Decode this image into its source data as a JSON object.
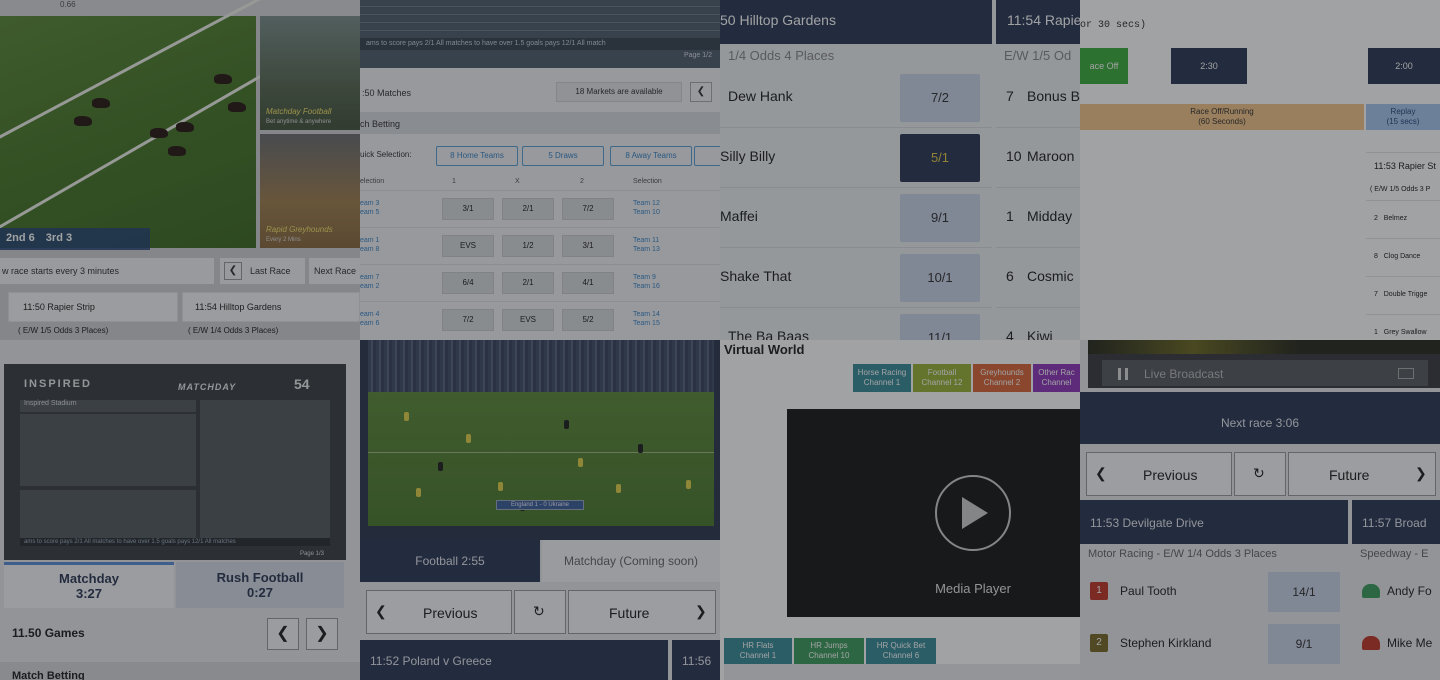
{
  "tile1": {
    "topstrip_text": "0.66",
    "hud": [
      "2nd 6",
      "3rd 3"
    ],
    "thumbs": [
      {
        "caption": "Matchday Football",
        "sub": "Bet anytime & anywhere"
      },
      {
        "caption": "Rapid Greyhounds",
        "sub": "Every 2 Mins"
      }
    ],
    "info_text": "w race starts every 3 minutes",
    "last_race": "Last Race",
    "next_race": "Next Race",
    "races": [
      {
        "name": "11:50 Rapier Strip",
        "odds": "( E/W 1/5 Odds 3 Places)"
      },
      {
        "name": "11:54 Hilltop Gardens",
        "odds": "( E/W 1/4 Odds 3 Places)"
      }
    ]
  },
  "tile2": {
    "ticker": "ams to score pays 2/1     All matches to have over 1.5 goals pays 12/1     All match",
    "page": "Page 1/2",
    "matches_label": ":50 Matches",
    "markets": "18 Markets are available",
    "match_betting": "ch Betting",
    "quick_selection": "uick Selection:",
    "quick_buttons": [
      "8 Home Teams",
      "5 Draws",
      "8 Away Teams"
    ],
    "col_headers": {
      "selection": "election",
      "c1": "1",
      "cx": "X",
      "c2": "2",
      "selection2": "Selection"
    },
    "rows": [
      {
        "home": "eam 3",
        "away": "eam 5",
        "o1": "3/1",
        "ox": "2/1",
        "o2": "7/2",
        "r1": "Team 12",
        "r2": "Team 10"
      },
      {
        "home": "eam 1",
        "away": "eam 8",
        "o1": "EVS",
        "ox": "1/2",
        "o2": "3/1",
        "r1": "Team 11",
        "r2": "Team 13"
      },
      {
        "home": "eam 7",
        "away": "eam 2",
        "o1": "6/4",
        "ox": "2/1",
        "o2": "4/1",
        "r1": "Team 9",
        "r2": "Team 16"
      },
      {
        "home": "eam 4",
        "away": "eam 6",
        "o1": "7/2",
        "ox": "EVS",
        "o2": "5/2",
        "r1": "Team 14",
        "r2": "Team 15"
      }
    ]
  },
  "tile3": {
    "header1": "50 Hilltop Gardens",
    "header2": "11:54 Rapier",
    "sub1": "1/4 Odds 4 Places",
    "sub2": "E/W 1/5 Od",
    "runners": [
      {
        "name": "Dew Hank",
        "price": "7/2"
      },
      {
        "name": "Silly Billy",
        "price": "5/1"
      },
      {
        "name": "Maffei",
        "price": "9/1"
      },
      {
        "name": "Shake That",
        "price": "10/1"
      },
      {
        "name": "The Ba Baas",
        "price": "11/1"
      }
    ],
    "runners2": [
      {
        "num": "7",
        "name": "Bonus B"
      },
      {
        "num": "10",
        "name": "Maroon"
      },
      {
        "num": "1",
        "name": "Midday"
      },
      {
        "num": "6",
        "name": "Cosmic"
      },
      {
        "num": "4",
        "name": "Kiwi"
      }
    ]
  },
  "tile4": {
    "code_text": "or 30 secs)",
    "blocks": [
      "ace Off",
      "2:30",
      "2:00"
    ],
    "band1": [
      "Race Off/Running",
      "(60 Seconds)"
    ],
    "band2": [
      "Replay",
      "(15 secs)"
    ],
    "race_name": "11:53 Rapier St",
    "race_odds": "( E/W 1/5 Odds 3 P",
    "entries": [
      {
        "num": "2",
        "name": "Belmez"
      },
      {
        "num": "8",
        "name": "Clog Dance"
      },
      {
        "num": "7",
        "name": "Double Trigge"
      },
      {
        "num": "1",
        "name": "Grey Swallow"
      }
    ]
  },
  "tile5": {
    "brand": "INSPIRED",
    "matchday": "MATCHDAY",
    "number": "54",
    "stadium": "Inspired Stadium",
    "ticker": "ams to score pays 2/1     All matches to have over 1.5 goals pays 12/1     All matches",
    "page": "Page 1/3",
    "tabs": [
      {
        "name": "Matchday",
        "time": "3:27"
      },
      {
        "name": "Rush Football",
        "time": "0:27"
      }
    ],
    "games": "11.50 Games",
    "match_betting": "Match Betting"
  },
  "tile6": {
    "score": "England 1 - 0 Ukraine",
    "tab_active": "Football 2:55",
    "tab_inactive": "Matchday (Coming soon)",
    "previous": "Previous",
    "future": "Future",
    "match1": "11:52 Poland v Greece",
    "match2": "11:56"
  },
  "tile7": {
    "title": "Virtual World",
    "channels": [
      {
        "l1": "Horse Racing",
        "l2": "Channel 1",
        "color": "#3b8c98"
      },
      {
        "l1": "Football",
        "l2": "Channel 12",
        "color": "#9cb33a"
      },
      {
        "l1": "Greyhounds",
        "l2": "Channel 2",
        "color": "#d9683a"
      },
      {
        "l1": "Other Rac",
        "l2": "Channel",
        "color": "#8e3ab8"
      }
    ],
    "media_label": "Media Player",
    "bottom_channels": [
      {
        "l1": "HR Flats",
        "l2": "Channel 1",
        "color": "#3b8c98"
      },
      {
        "l1": "HR Jumps",
        "l2": "Channel 10",
        "color": "#3f9c5c"
      },
      {
        "l1": "HR Quick Bet",
        "l2": "Channel 6",
        "color": "#3b8c98"
      }
    ]
  },
  "tile8": {
    "live": "Live Broadcast",
    "next_race": "Next race 3:06",
    "previous": "Previous",
    "future": "Future",
    "race1": "11:53 Devilgate Drive",
    "race2": "11:57 Broad",
    "cat1": "Motor Racing - E/W 1/4 Odds 3 Places",
    "cat2": "Speedway - E",
    "riders": [
      {
        "num": "1",
        "name": "Paul Tooth",
        "price": "14/1",
        "color": "#c0392b"
      },
      {
        "num": "2",
        "name": "Stephen Kirkland",
        "price": "9/1",
        "color": "#7a6a2a"
      }
    ],
    "riders2": [
      {
        "name": "Andy Fo",
        "color": "#3f9c5c"
      },
      {
        "name": "Mike Me",
        "color": "#c0392b"
      }
    ]
  }
}
